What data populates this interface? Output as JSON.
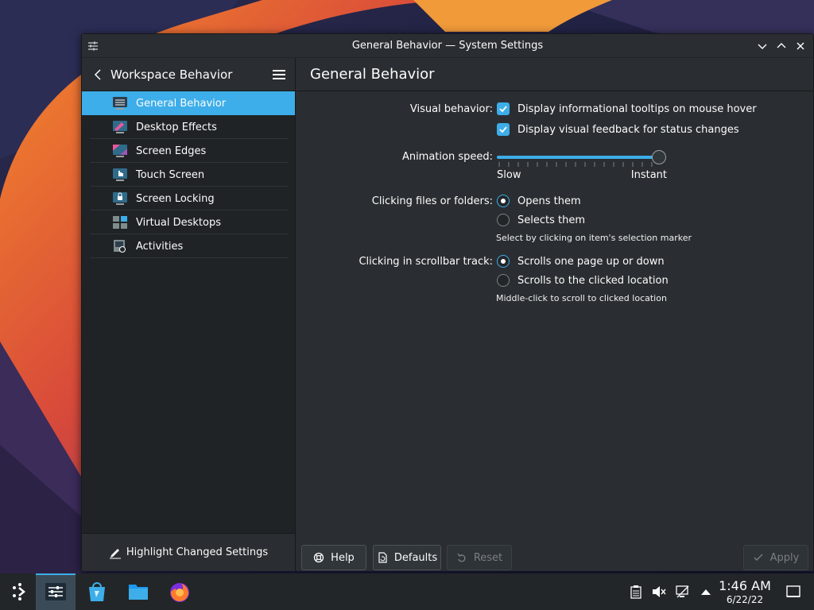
{
  "window": {
    "title": "General Behavior — System Settings"
  },
  "sidebar": {
    "header_title": "Workspace Behavior",
    "items": [
      {
        "label": "General Behavior",
        "icon": "general-behavior-icon",
        "active": true
      },
      {
        "label": "Desktop Effects",
        "icon": "desktop-effects-icon"
      },
      {
        "label": "Screen Edges",
        "icon": "screen-edges-icon"
      },
      {
        "label": "Touch Screen",
        "icon": "touch-screen-icon"
      },
      {
        "label": "Screen Locking",
        "icon": "screen-locking-icon"
      },
      {
        "label": "Virtual Desktops",
        "icon": "virtual-desktops-icon"
      },
      {
        "label": "Activities",
        "icon": "activities-icon"
      }
    ],
    "footer_label": "Highlight Changed Settings"
  },
  "content": {
    "title": "General Behavior",
    "visual_behavior": {
      "label": "Visual behavior:",
      "options": [
        {
          "label": "Display informational tooltips on mouse hover",
          "checked": true
        },
        {
          "label": "Display visual feedback for status changes",
          "checked": true
        }
      ]
    },
    "animation_speed": {
      "label": "Animation speed:",
      "min_label": "Slow",
      "max_label": "Instant",
      "value_fraction": 1.0
    },
    "clicking_files": {
      "label": "Clicking files or folders:",
      "options": [
        {
          "label": "Opens them",
          "selected": true
        },
        {
          "label": "Selects them",
          "selected": false
        }
      ],
      "hint": "Select by clicking on item's selection marker"
    },
    "scrollbar_track": {
      "label": "Clicking in scrollbar track:",
      "options": [
        {
          "label": "Scrolls one page up or down",
          "selected": true
        },
        {
          "label": "Scrolls to the clicked location",
          "selected": false
        }
      ],
      "hint": "Middle-click to scroll to clicked location"
    }
  },
  "buttons": {
    "help": "Help",
    "defaults": "Defaults",
    "reset": "Reset",
    "apply": "Apply"
  },
  "taskbar": {
    "apps": [
      "application-launcher-icon",
      "system-settings-icon",
      "discover-icon",
      "file-manager-icon",
      "firefox-icon"
    ],
    "tray": [
      "clipboard-icon",
      "volume-muted-icon",
      "network-icon",
      "expand-tray-icon"
    ],
    "time": "1:46 AM",
    "date": "6/22/22"
  },
  "colors": {
    "accent": "#3daee9",
    "window_bg": "#2a2e32",
    "sidebar_bg": "#202326",
    "taskbar_bg": "#232629"
  }
}
